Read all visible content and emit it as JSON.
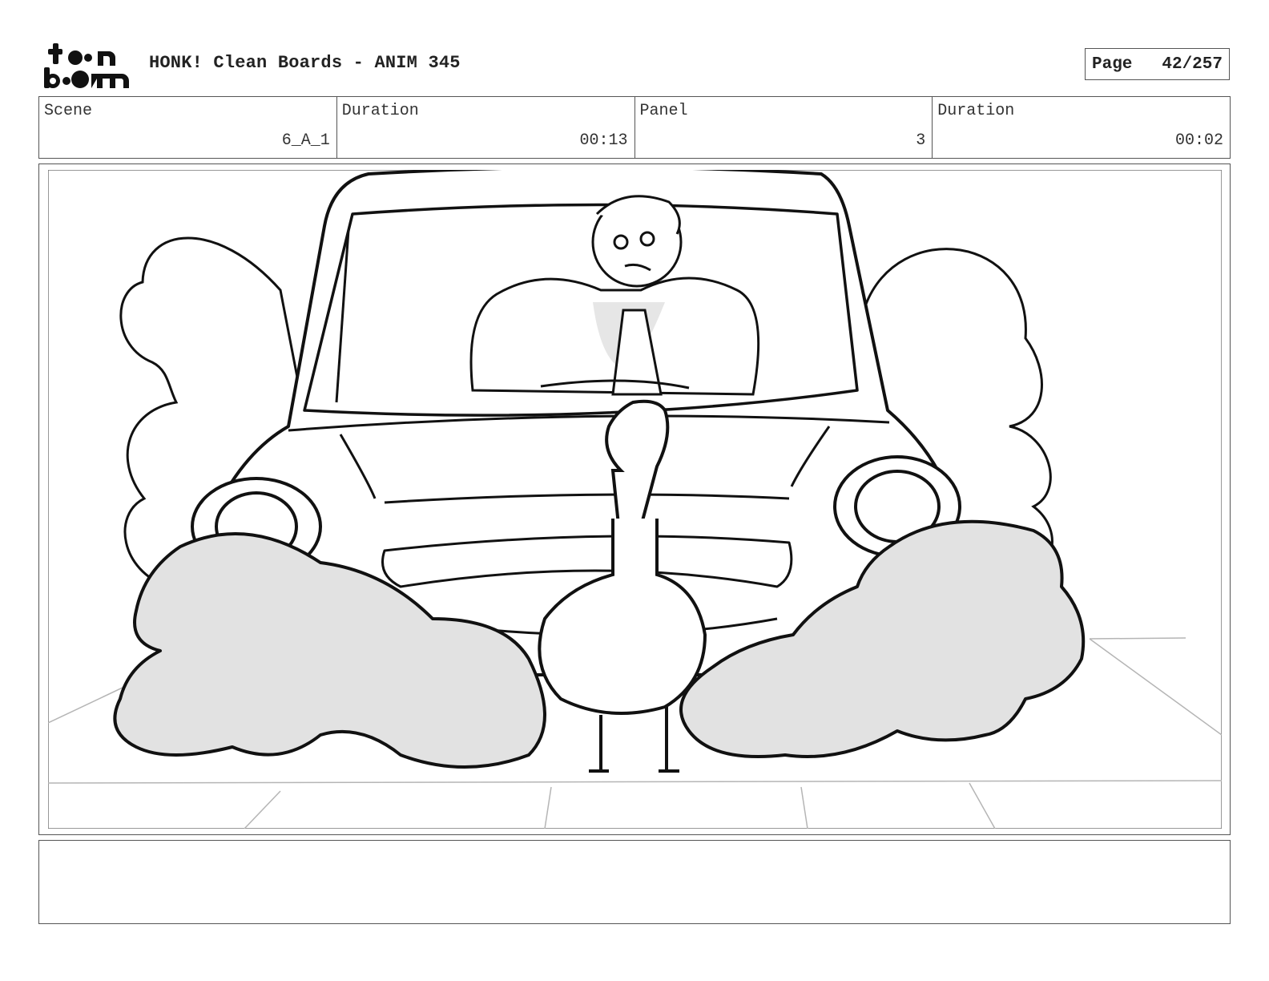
{
  "header": {
    "logo_text": "toon boom",
    "title": "HONK! Clean Boards - ANIM 345",
    "page_label": "Page",
    "page_value": "42/257"
  },
  "info": {
    "scene_label": "Scene",
    "scene_value": "6_A_1",
    "scene_duration_label": "Duration",
    "scene_duration_value": "00:13",
    "panel_label": "Panel",
    "panel_value": "3",
    "panel_duration_label": "Duration",
    "panel_duration_value": "00:02"
  },
  "notes": {
    "text": ""
  }
}
